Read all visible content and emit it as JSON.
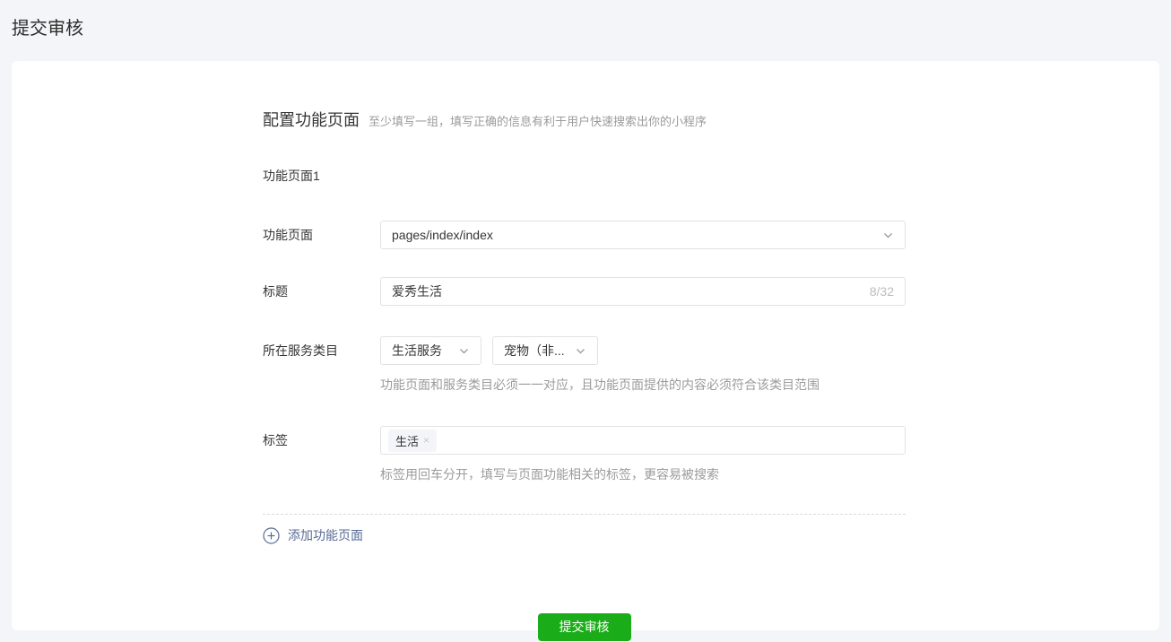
{
  "page": {
    "title": "提交审核"
  },
  "section": {
    "title": "配置功能页面",
    "subtitle": "至少填写一组，填写正确的信息有利于用户快速搜索出你的小程序",
    "group_title": "功能页面1"
  },
  "form": {
    "page_path": {
      "label": "功能页面",
      "value": "pages/index/index"
    },
    "title_field": {
      "label": "标题",
      "value": "爱秀生活",
      "counter": "8/32"
    },
    "category": {
      "label": "所在服务类目",
      "primary_value": "生活服务",
      "secondary_value": "宠物（非...",
      "helper": "功能页面和服务类目必须一一对应，且功能页面提供的内容必须符合该类目范围"
    },
    "tags": {
      "label": "标签",
      "chips": [
        {
          "text": "生活",
          "remove": "×"
        }
      ],
      "helper": "标签用回车分开，填写与页面功能相关的标签，更容易被搜索"
    }
  },
  "actions": {
    "add_page_label": "添加功能页面",
    "submit_label": "提交审核"
  },
  "colors": {
    "page_background": "#f4f5f8",
    "link": "#576b95",
    "primary_green": "#1aad19",
    "helper_text": "#9b9b9b",
    "border": "#e2e2e2"
  }
}
